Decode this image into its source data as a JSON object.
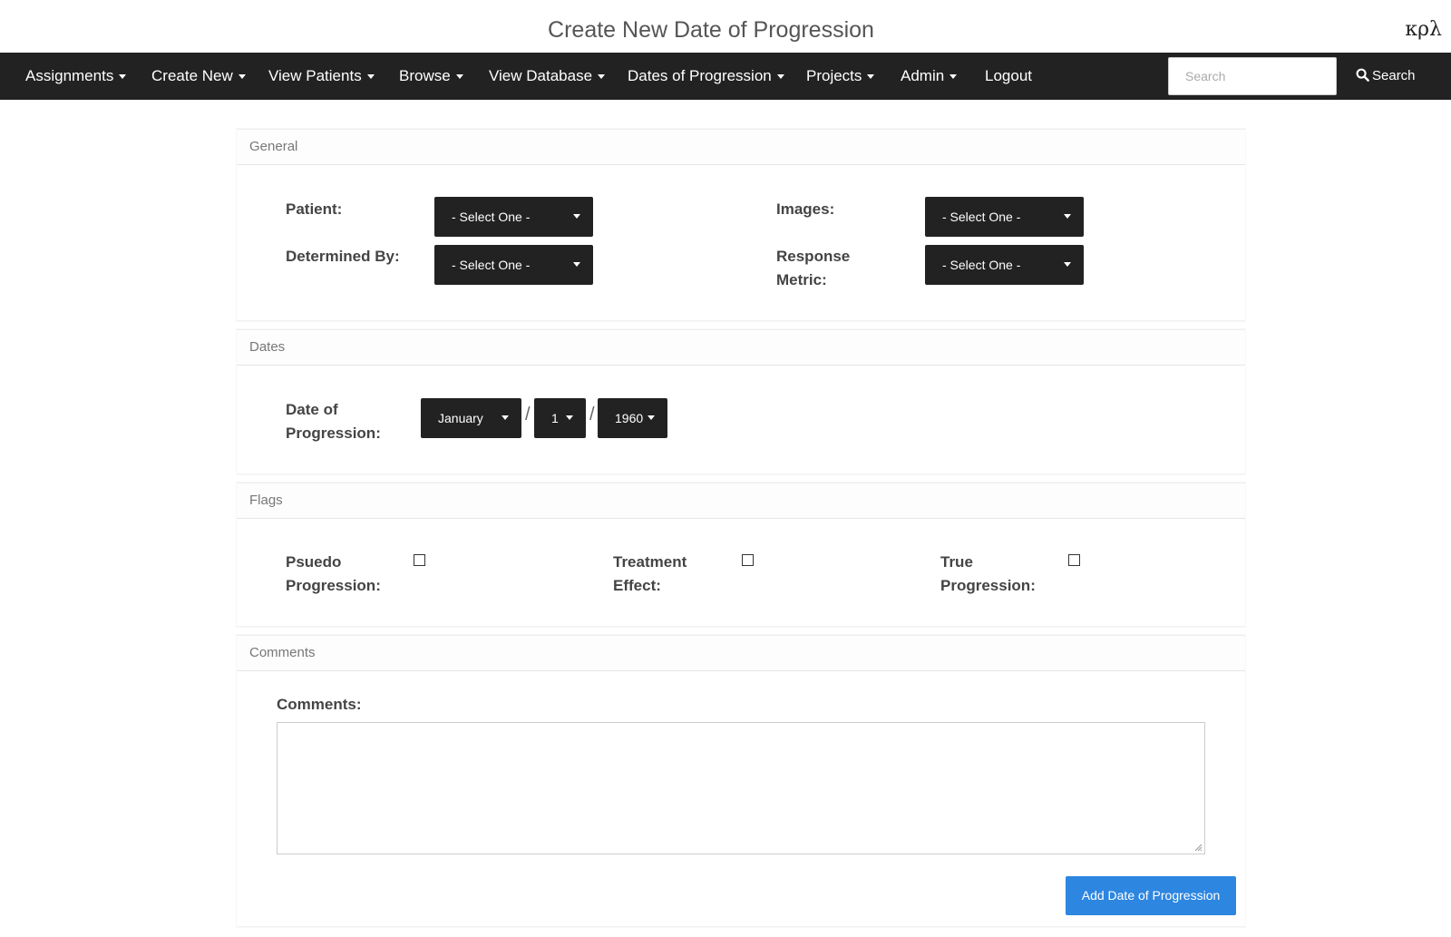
{
  "header": {
    "title": "Create New Date of Progression",
    "brand": "κρλ"
  },
  "navbar": {
    "items": [
      {
        "label": "Assignments",
        "dropdown": true
      },
      {
        "label": "Create New",
        "dropdown": true
      },
      {
        "label": "View Patients",
        "dropdown": true
      },
      {
        "label": "Browse",
        "dropdown": true
      },
      {
        "label": "View Database",
        "dropdown": true
      },
      {
        "label": "Dates of Progression",
        "dropdown": true
      },
      {
        "label": "Projects",
        "dropdown": true
      },
      {
        "label": "Admin",
        "dropdown": true
      },
      {
        "label": "Logout",
        "dropdown": false
      }
    ],
    "search_placeholder": "Search",
    "search_button": "Search"
  },
  "general": {
    "heading": "General",
    "patient_label": "Patient:",
    "patient_value": "- Select One -",
    "images_label": "Images:",
    "images_value": "- Select One -",
    "determined_by_label": "Determined By:",
    "determined_by_value": "- Select One -",
    "response_metric_label_line1": "Response",
    "response_metric_label_line2": "Metric:",
    "response_metric_value": "- Select One -"
  },
  "dates": {
    "heading": "Dates",
    "label_line1": "Date of",
    "label_line2": "Progression:",
    "month": "January",
    "day": "1",
    "year": "1960",
    "separator": "/"
  },
  "flags": {
    "heading": "Flags",
    "items": [
      {
        "line1": "Psuedo",
        "line2": "Progression:",
        "checked": false
      },
      {
        "line1": "Treatment",
        "line2": "Effect:",
        "checked": false
      },
      {
        "line1": "True",
        "line2": "Progression:",
        "checked": false
      }
    ]
  },
  "comments": {
    "heading": "Comments",
    "label": "Comments:",
    "value": ""
  },
  "submit_label": "Add Date of Progression",
  "colors": {
    "navbar_bg": "#222222",
    "dropdown_bg": "#222222",
    "primary_button": "#2d86e0"
  }
}
